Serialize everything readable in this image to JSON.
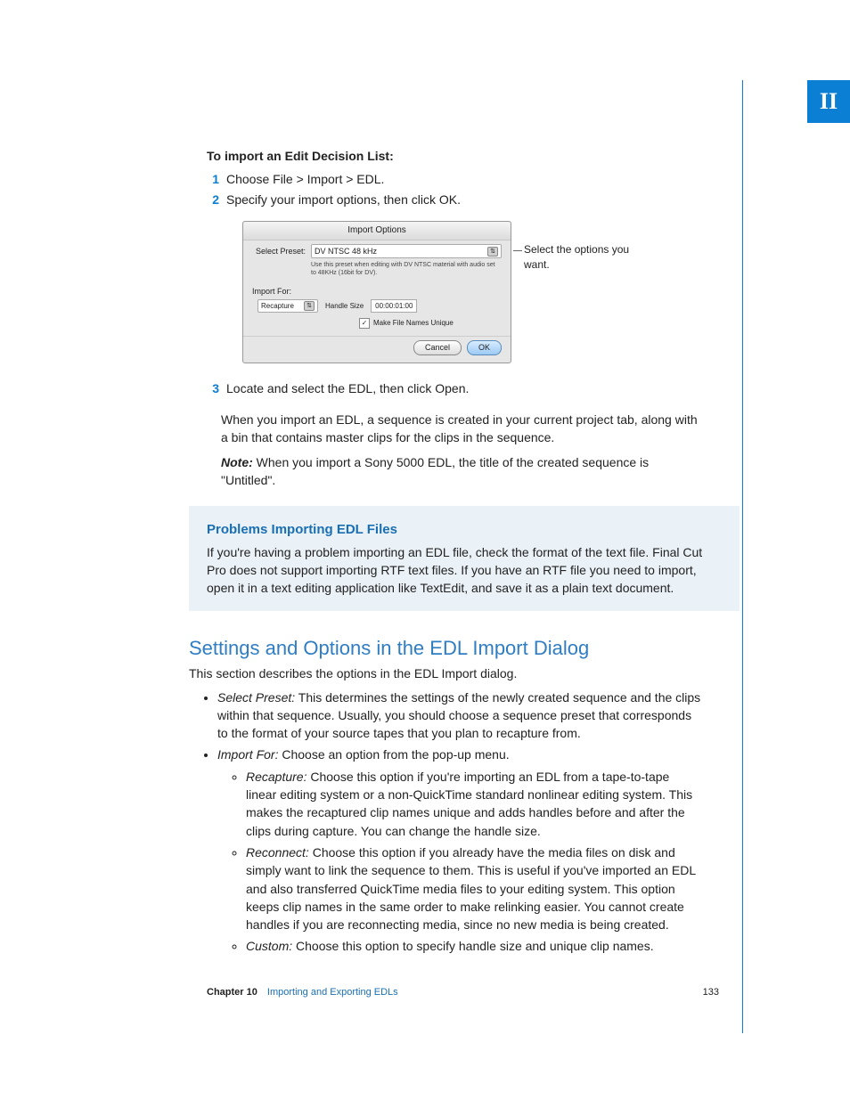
{
  "tab": "II",
  "instruction_title": "To import an Edit Decision List:",
  "steps": [
    {
      "n": "1",
      "text": "Choose File > Import > EDL."
    },
    {
      "n": "2",
      "text": "Specify your import options, then click OK."
    },
    {
      "n": "3",
      "text": "Locate and select the EDL, then click Open."
    }
  ],
  "callout": "Select the options you want.",
  "dialog": {
    "title": "Import Options",
    "select_preset_label": "Select Preset:",
    "preset_value": "DV NTSC 48 kHz",
    "preset_desc": "Use this preset when editing with DV NTSC material with audio set to 48KHz (16bit for DV).",
    "import_for_label": "Import For:",
    "import_for_value": "Recapture",
    "handle_label": "Handle Size",
    "handle_value": "00:00:01:00",
    "checkbox_label": "Make File Names Unique",
    "cancel": "Cancel",
    "ok": "OK"
  },
  "after_step3_p1": "When you import an EDL, a sequence is created in your current project tab, along with a bin that contains master clips for the clips in the sequence.",
  "note_label": "Note:",
  "note_text": " When you import a Sony 5000 EDL, the title of the created sequence is \"Untitled\".",
  "sidebar": {
    "title": "Problems Importing EDL Files",
    "body": "If you're having a problem importing an EDL file, check the format of the text file. Final Cut Pro does not support importing RTF text files. If you have an RTF file you need to import, open it in a text editing application like TextEdit, and save it as a plain text document."
  },
  "h2": "Settings and Options in the EDL Import Dialog",
  "h2_intro": "This section describes the options in the EDL Import dialog.",
  "bullets": {
    "select_preset_term": "Select Preset:",
    "select_preset_body": " This determines the settings of the newly created sequence and the clips within that sequence. Usually, you should choose a sequence preset that corresponds to the format of your source tapes that you plan to recapture from.",
    "import_for_term": "Import For:",
    "import_for_body": " Choose an option from the pop-up menu.",
    "recapture_term": "Recapture:",
    "recapture_body": " Choose this option if you're importing an EDL from a tape-to-tape linear editing system or a non-QuickTime standard nonlinear editing system. This makes the recaptured clip names unique and adds handles before and after the clips during capture. You can change the handle size.",
    "reconnect_term": "Reconnect:",
    "reconnect_body": " Choose this option if you already have the media files on disk and simply want to link the sequence to them. This is useful if you've imported an EDL and also transferred QuickTime media files to your editing system. This option keeps clip names in the same order to make relinking easier. You cannot create handles if you are reconnecting media, since no new media is being created.",
    "custom_term": "Custom:",
    "custom_body": " Choose this option to specify handle size and unique clip names."
  },
  "footer": {
    "chapter_label": "Chapter 10",
    "chapter_title": "Importing and Exporting EDLs",
    "page": "133"
  }
}
